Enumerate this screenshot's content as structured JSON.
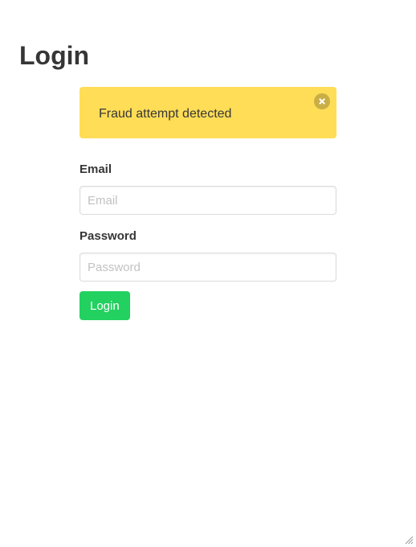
{
  "page": {
    "title": "Login"
  },
  "notification": {
    "message": "Fraud attempt detected",
    "color": "#ffdd57",
    "close_icon": "close-circle-icon"
  },
  "form": {
    "email": {
      "label": "Email",
      "value": "",
      "placeholder": "Email"
    },
    "password": {
      "label": "Password",
      "value": "",
      "placeholder": "Password"
    },
    "submit_label": "Login",
    "submit_color": "#23d160"
  },
  "window": {
    "resize_icon": "resize-grip-icon"
  }
}
